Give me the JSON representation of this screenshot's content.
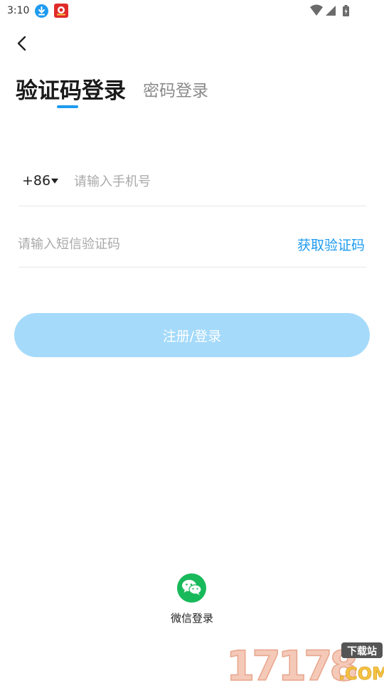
{
  "status_bar": {
    "time": "3:10"
  },
  "tabs": {
    "active_label": "验证码登录",
    "inactive_label": "密码登录"
  },
  "phone": {
    "country_code": "+86",
    "placeholder": "请输入手机号",
    "value": ""
  },
  "sms_code": {
    "placeholder": "请输入短信验证码",
    "value": "",
    "get_code_label": "获取验证码"
  },
  "login_button": {
    "label": "注册/登录"
  },
  "wechat": {
    "label": "微信登录"
  },
  "watermark": {
    "number": "17178",
    "tag": "下载站",
    "domain": ".COM"
  },
  "colors": {
    "accent": "#1d9bf0",
    "button_disabled": "#a5dafa",
    "wechat_green": "#18b95a",
    "placeholder": "#a9a9a9",
    "divider": "#e7e7e7"
  },
  "icons": [
    "download-icon",
    "app-badge-icon",
    "wifi-icon",
    "signal-icon",
    "battery-icon",
    "back-arrow-icon",
    "caret-down-icon",
    "wechat-icon"
  ]
}
